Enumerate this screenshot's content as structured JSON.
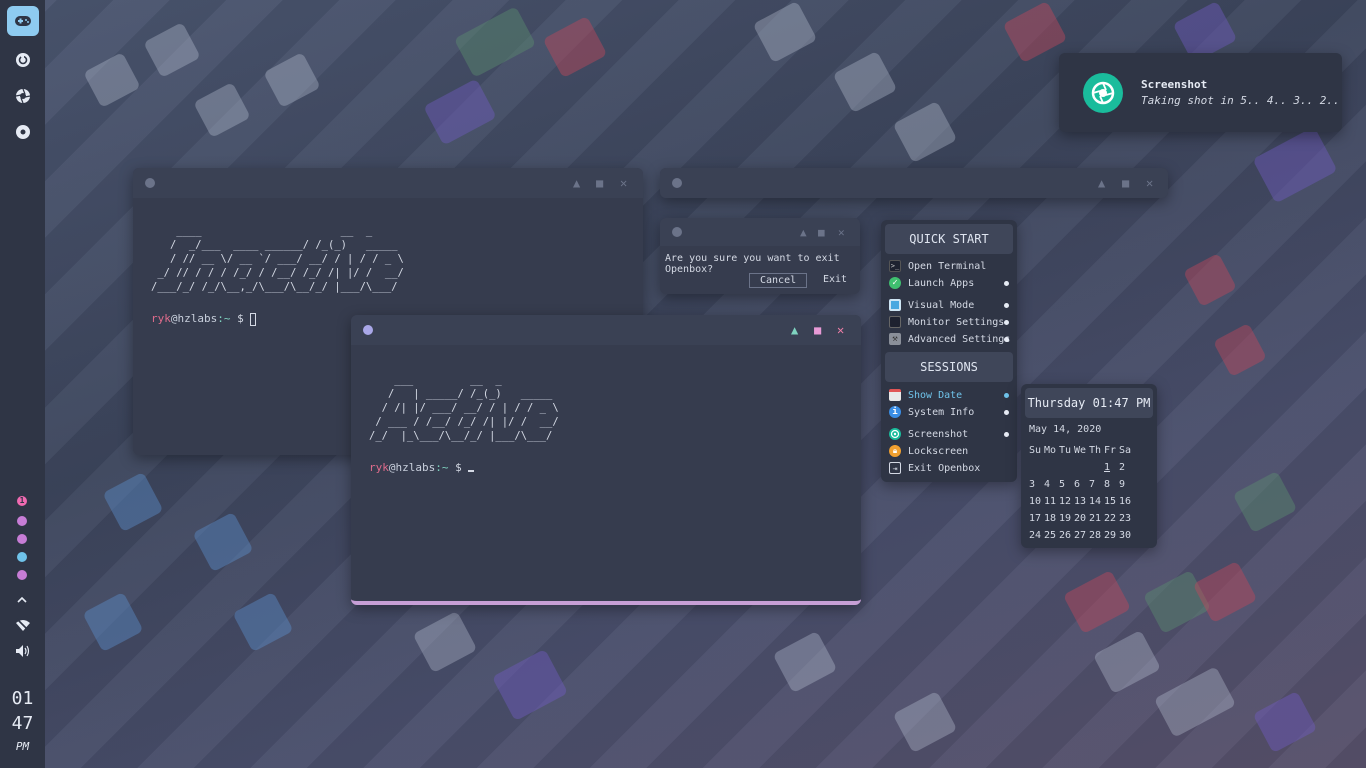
{
  "panel": {
    "launcher_icon": "gamepad-icon",
    "icons": [
      "refresh-icon",
      "camera-aperture-icon",
      "disc-icon"
    ],
    "workspaces": [
      {
        "label": "1",
        "color": "#f06ab1",
        "active": true
      },
      {
        "label": "",
        "color": "#c77dd6"
      },
      {
        "label": "",
        "color": "#c77dd6"
      },
      {
        "label": "",
        "color": "#6fc3ea"
      },
      {
        "label": "",
        "color": "#c77dd6"
      }
    ],
    "tray_icons": [
      "chevron-up-icon",
      "wifi-off-icon",
      "volume-icon"
    ],
    "clock": {
      "hour": "01",
      "minute": "47",
      "ampm": "PM"
    }
  },
  "terminal_back": {
    "ascii": "    ____                      __  _\n   /  _/___  ____ ______/ /_(_)   _____\n   / // __ \\/ __ `/ ___/ __/ / | / / _ \\\n _/ // / / / /_/ / /__/ /_/ /| |/ /  __/\n/___/_/ /_/\\__,_/\\___/\\__/_/ |___/\\___/",
    "prompt_user": "ryk",
    "prompt_host": "@hzlabs",
    "prompt_path": ":~",
    "prompt_symbol": " $ "
  },
  "terminal_front": {
    "ascii": "    ___         __  _\n   /   | _____/ /_(_)   _____\n  / /| |/ ___/ __/ / | / / _ \\\n / ___ / /__/ /_/ /| |/ /  __/\n/_/  |_\\___/\\__/_/ |___/\\___/",
    "prompt_user": "ryk",
    "prompt_host": "@hzlabs",
    "prompt_path": ":~",
    "prompt_symbol": " $ "
  },
  "dialog": {
    "message": "Are you sure you want to exit Openbox?",
    "cancel": "Cancel",
    "exit": "Exit"
  },
  "menu": {
    "quick_start_title": "QUICK START",
    "quick_items": [
      {
        "label": "Open Terminal",
        "icon": "terminal-icon",
        "submenu": false
      },
      {
        "label": "Launch Apps",
        "icon": "check-circle-icon",
        "submenu": true
      },
      {
        "label": "Visual Mode",
        "icon": "monitor-icon",
        "submenu": true
      },
      {
        "label": "Monitor Settings",
        "icon": "display-icon",
        "submenu": true
      },
      {
        "label": "Advanced Settings",
        "icon": "tools-icon",
        "submenu": true
      }
    ],
    "sessions_title": "SESSIONS",
    "session_items": [
      {
        "label": "Show Date",
        "icon": "calendar-icon",
        "submenu": true,
        "highlight": true
      },
      {
        "label": "System Info",
        "icon": "info-icon",
        "submenu": true
      },
      {
        "label": "Screenshot",
        "icon": "camera-aperture-icon",
        "submenu": true
      },
      {
        "label": "Lockscreen",
        "icon": "lock-icon",
        "submenu": false
      },
      {
        "label": "Exit Openbox",
        "icon": "logout-icon",
        "submenu": false
      }
    ]
  },
  "calendar": {
    "header": "Thursday 01:47 PM",
    "date": "May 14, 2020",
    "weekdays": [
      "Su",
      "Mo",
      "Tu",
      "We",
      "Th",
      "Fr",
      "Sa"
    ],
    "days": [
      "",
      "",
      "",
      "",
      "",
      "1",
      "2",
      "3",
      "4",
      "5",
      "6",
      "7",
      "8",
      "9",
      "10",
      "11",
      "12",
      "13",
      "14",
      "15",
      "16",
      "17",
      "18",
      "19",
      "20",
      "21",
      "22",
      "23",
      "24",
      "25",
      "26",
      "27",
      "28",
      "29",
      "30"
    ]
  },
  "notification": {
    "title": "Screenshot",
    "body": "Taking shot in 5.. 4.. 3.. 2..",
    "icon": "camera-aperture-icon"
  },
  "colors": {
    "accent_pink": "#f06ab1",
    "accent_blue": "#8ecbf0",
    "accent_teal": "#1abc9c",
    "close_red": "#f07fa8",
    "panel_bg": "#2f3545",
    "window_bg": "#363c4e"
  }
}
